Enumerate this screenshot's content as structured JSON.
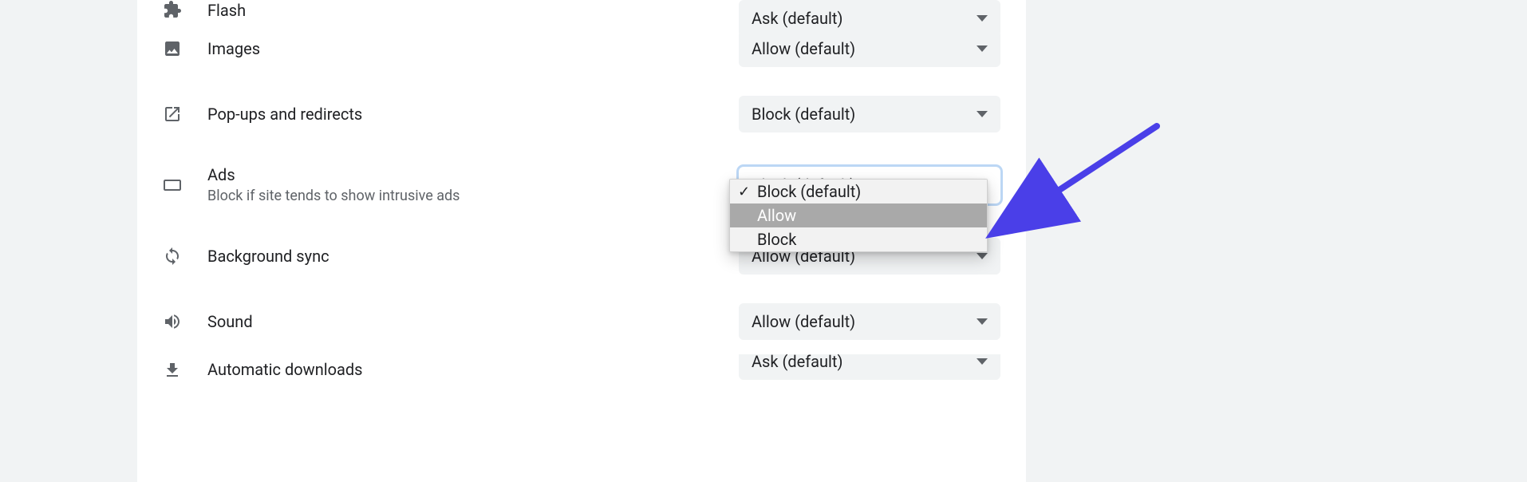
{
  "rows": {
    "flash": {
      "label": "Flash",
      "value": "Ask (default)"
    },
    "images": {
      "label": "Images",
      "value": "Allow (default)"
    },
    "popups": {
      "label": "Pop-ups and redirects",
      "value": "Block (default)"
    },
    "ads": {
      "label": "Ads",
      "sub": "Block if site tends to show intrusive ads",
      "value": "Block (default)"
    },
    "bgsync": {
      "label": "Background sync",
      "value": "Allow (default)"
    },
    "sound": {
      "label": "Sound",
      "value": "Allow (default)"
    },
    "autodl": {
      "label": "Automatic downloads",
      "value": "Ask (default)"
    }
  },
  "dropdown": {
    "options": {
      "opt0": "Block (default)",
      "opt1": "Allow",
      "opt2": "Block"
    }
  }
}
